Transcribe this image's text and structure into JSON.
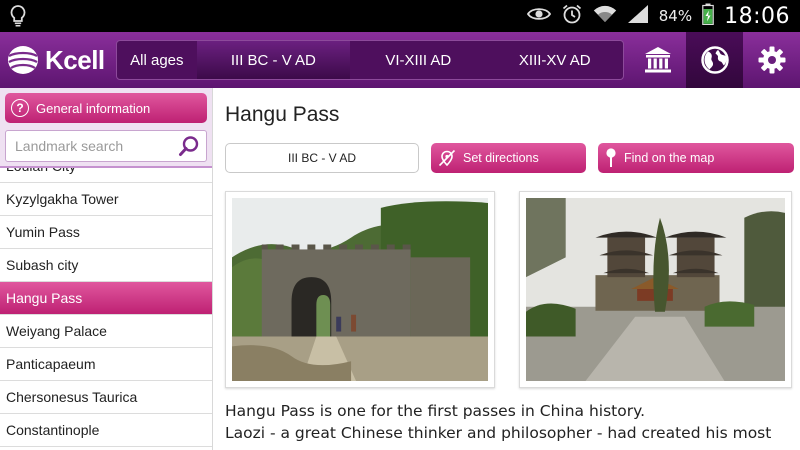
{
  "status_bar": {
    "battery": "84%",
    "time": "18:06",
    "icons": [
      "bulb-icon",
      "eye-icon",
      "alarm-icon",
      "wifi-icon",
      "signal-icon",
      "battery-charging-icon"
    ]
  },
  "header": {
    "logo_text": "Kcell",
    "eras": [
      "All ages",
      "III BC - V AD",
      "VI-XIII AD",
      "XIII-XV AD"
    ],
    "active_era": "III BC - V AD",
    "icons": [
      "museum-icon",
      "globe-icon",
      "gear-icon"
    ],
    "active_icon": "globe-icon"
  },
  "sidebar": {
    "general_info_label": "General information",
    "search_placeholder": "Landmark search",
    "items": [
      {
        "label": "Loulan City"
      },
      {
        "label": "Kyzylgakha Tower"
      },
      {
        "label": "Yumin Pass"
      },
      {
        "label": "Subash city"
      },
      {
        "label": "Hangu Pass"
      },
      {
        "label": "Weiyang Palace"
      },
      {
        "label": "Panticapaeum"
      },
      {
        "label": "Chersonesus Taurica"
      },
      {
        "label": "Constantinople"
      }
    ],
    "selected": "Hangu Pass"
  },
  "main": {
    "title": "Hangu Pass",
    "era_label": "III BC - V AD",
    "directions_label": "Set directions",
    "map_label": "Find on the map",
    "description": [
      "Hangu Pass is one for the first passes in China history.",
      "Laozi - a great Chinese thinker and philosopher - had created his most"
    ]
  },
  "colors": {
    "brand_purple": "#6a1f7d",
    "accent_pink": "#d23a8a",
    "status_bar": "#000000"
  }
}
